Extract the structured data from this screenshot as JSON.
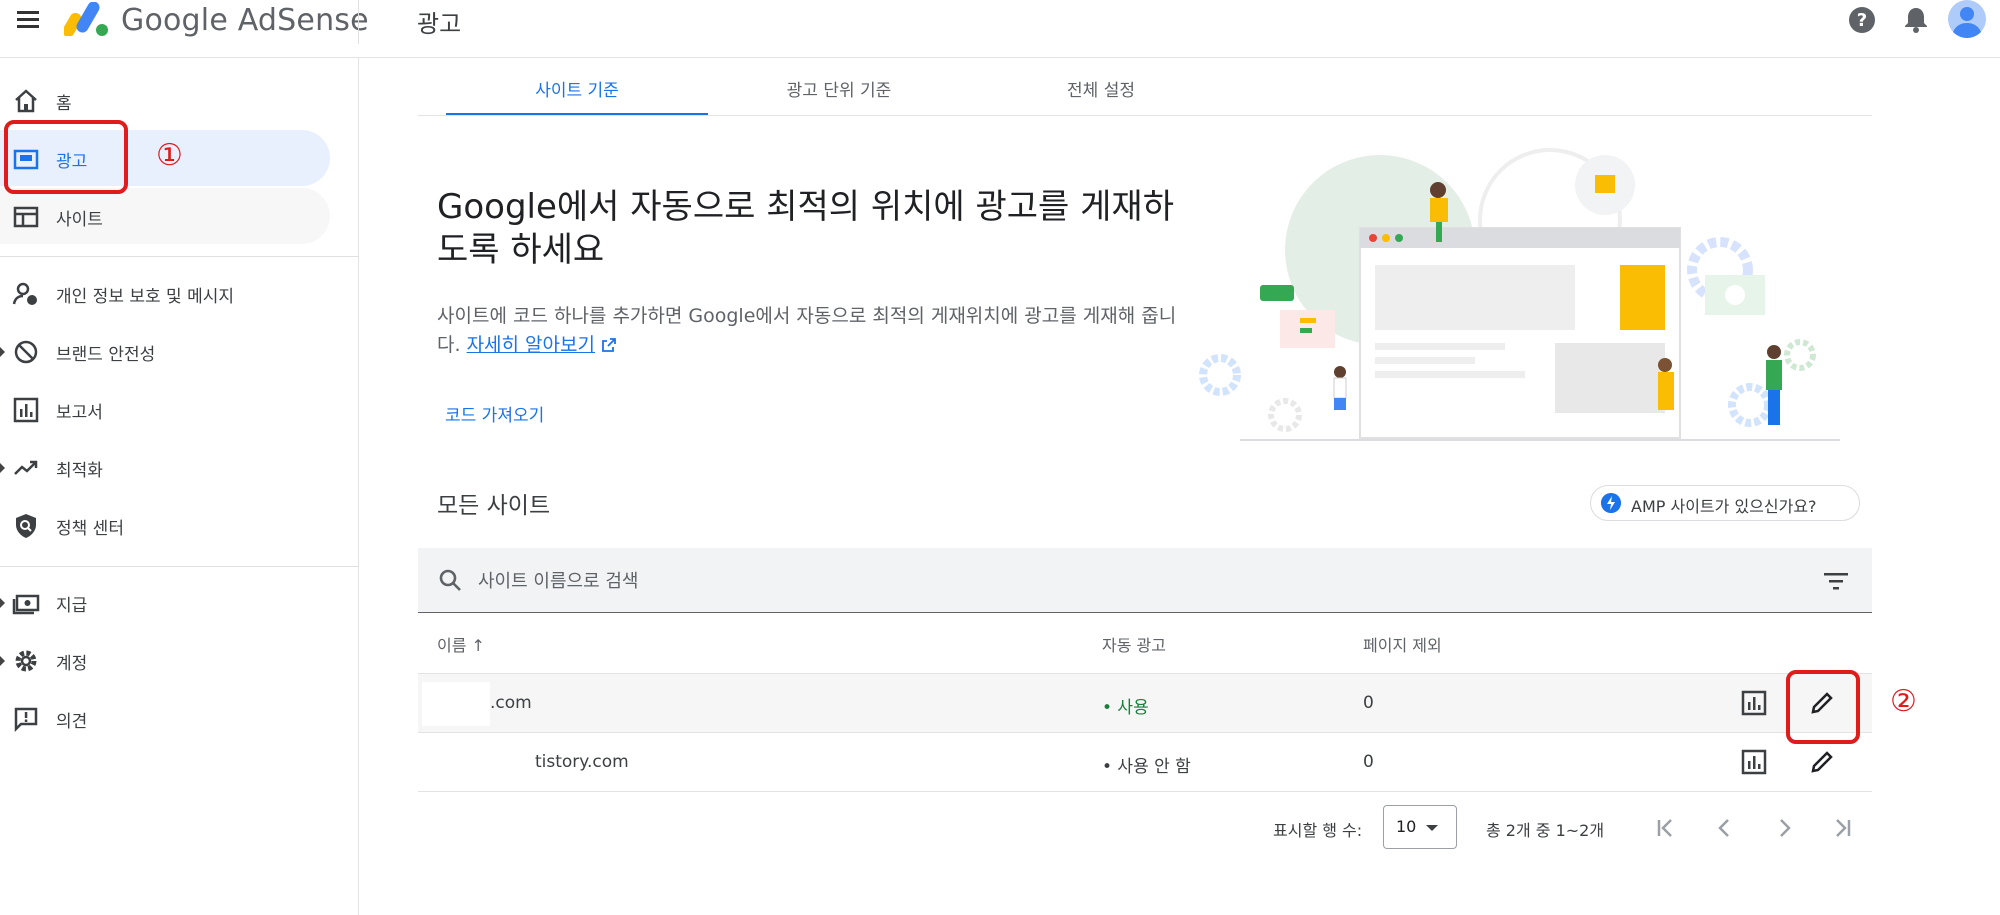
{
  "header": {
    "product_name": "Google AdSense",
    "page_title": "광고"
  },
  "sidebar": {
    "items": [
      {
        "label": "홈",
        "icon": "home-icon"
      },
      {
        "label": "광고",
        "icon": "ads-icon"
      },
      {
        "label": "사이트",
        "icon": "sites-icon"
      },
      {
        "label": "개인 정보 보호 및 메시지",
        "icon": "privacy-messaging-icon"
      },
      {
        "label": "브랜드 안전성",
        "icon": "block-icon"
      },
      {
        "label": "보고서",
        "icon": "reports-icon"
      },
      {
        "label": "최적화",
        "icon": "trending-up-icon"
      },
      {
        "label": "정책 센터",
        "icon": "policy-shield-icon"
      },
      {
        "label": "지급",
        "icon": "payments-icon"
      },
      {
        "label": "계정",
        "icon": "gear-icon"
      },
      {
        "label": "의견",
        "icon": "feedback-icon"
      }
    ]
  },
  "annotations": {
    "first": "①",
    "second": "②"
  },
  "tabs": [
    {
      "label": "사이트 기준"
    },
    {
      "label": "광고 단위 기준"
    },
    {
      "label": "전체 설정"
    }
  ],
  "hero": {
    "title": "Google에서 자동으로 최적의 위치에 광고를 게재하도록 하세요",
    "description": "사이트에 코드 하나를 추가하면 Google에서 자동으로 최적의 게재위치에 광고를 게재해 줍니다.",
    "learn_more": "자세히 알아보기",
    "get_code": "코드 가져오기"
  },
  "all_sites": {
    "title": "모든 사이트",
    "amp_chip": "AMP 사이트가 있으신가요?",
    "search_placeholder": "사이트 이름으로 검색"
  },
  "table": {
    "columns": {
      "name": "이름",
      "auto_ads": "자동 광고",
      "page_exclusions": "페이지 제외"
    },
    "sort_arrow": "↑",
    "rows": [
      {
        "name": ".com",
        "auto_ads": "• 사용",
        "page_exclusions": "0"
      },
      {
        "name": "tistory.com",
        "auto_ads": "• 사용 안 함",
        "page_exclusions": "0"
      }
    ]
  },
  "pagination": {
    "rows_per_page_label": "표시할 행 수:",
    "rows_per_page": "10",
    "range": "총 2개 중 1~2개"
  },
  "colors": {
    "accent": "#1a73e8",
    "annotation_red": "#e01b1b",
    "active_nav_bg": "#e8f0fe",
    "status_on": "#188038"
  }
}
